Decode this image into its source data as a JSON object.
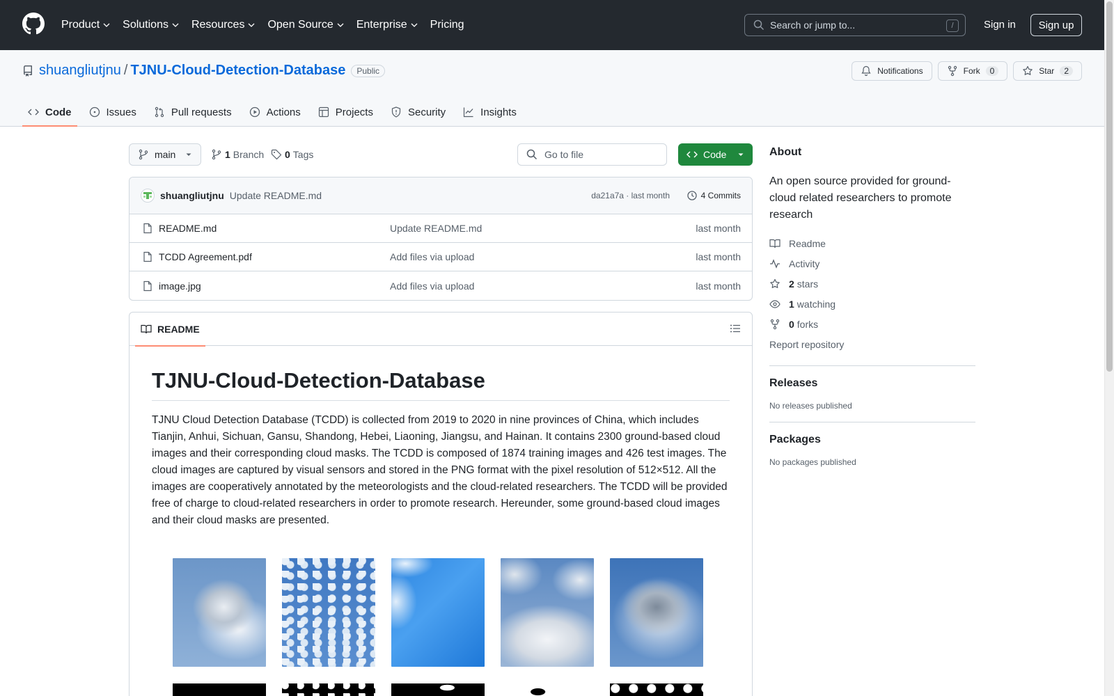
{
  "header": {
    "nav": [
      "Product",
      "Solutions",
      "Resources",
      "Open Source",
      "Enterprise",
      "Pricing"
    ],
    "search_placeholder": "Search or jump to...",
    "search_shortcut": "/",
    "sign_in": "Sign in",
    "sign_up": "Sign up"
  },
  "repo": {
    "owner": "shuangliutjnu",
    "separator": "/",
    "name": "TJNU-Cloud-Detection-Database",
    "visibility": "Public",
    "notifications_label": "Notifications",
    "fork_label": "Fork",
    "fork_count": "0",
    "star_label": "Star",
    "star_count": "2"
  },
  "tabs": [
    {
      "label": "Code",
      "icon": "code-icon"
    },
    {
      "label": "Issues",
      "icon": "issue-icon"
    },
    {
      "label": "Pull requests",
      "icon": "pull-request-icon"
    },
    {
      "label": "Actions",
      "icon": "play-icon"
    },
    {
      "label": "Projects",
      "icon": "table-icon"
    },
    {
      "label": "Security",
      "icon": "shield-icon"
    },
    {
      "label": "Insights",
      "icon": "graph-icon"
    }
  ],
  "toolbar": {
    "branch": "main",
    "branch_count": "1",
    "branch_label": "Branch",
    "tag_count": "0",
    "tag_label": "Tags",
    "go_to_file": "Go to file",
    "code_button": "Code"
  },
  "commit": {
    "author": "shuangliutjnu",
    "message": "Update README.md",
    "meta": "da21a7a · last month",
    "count_label": "4 Commits"
  },
  "files": [
    {
      "name": "README.md",
      "message": "Update README.md",
      "date": "last month"
    },
    {
      "name": "TCDD Agreement.pdf",
      "message": "Add files via upload",
      "date": "last month"
    },
    {
      "name": "image.jpg",
      "message": "Add files via upload",
      "date": "last month"
    }
  ],
  "readme": {
    "tab_label": "README",
    "title": "TJNU-Cloud-Detection-Database",
    "paragraph": "TJNU Cloud Detection Database (TCDD) is collected from 2019 to 2020 in nine provinces of China, which includes Tianjin, Anhui, Sichuan, Gansu, Shandong, Hebei, Liaoning, Jiangsu, and Hainan. It contains 2300 ground-based cloud images and their corresponding cloud masks. The TCDD is composed of 1874 training images and 426 test images. The cloud images are captured by visual sensors and stored in the PNG format with the pixel resolution of 512×512. All the images are cooperatively annotated by the meteorologists and the cloud-related researchers. The TCDD will be provided free of charge to cloud-related researchers in order to promote research. Hereunder, some ground-based cloud images and their cloud masks are presented."
  },
  "about": {
    "heading": "About",
    "description": "An open source provided for ground-cloud related researchers to promote research",
    "readme": "Readme",
    "activity": "Activity",
    "stars_count": "2",
    "stars_label": "stars",
    "watching_count": "1",
    "watching_label": "watching",
    "forks_count": "0",
    "forks_label": "forks",
    "report": "Report repository"
  },
  "releases": {
    "heading": "Releases",
    "empty": "No releases published"
  },
  "packages": {
    "heading": "Packages",
    "empty": "No packages published"
  },
  "colors": {
    "header_bg": "#24292f",
    "link": "#0969da",
    "code_button": "#1f883d",
    "tab_underline": "#fd8c73"
  }
}
